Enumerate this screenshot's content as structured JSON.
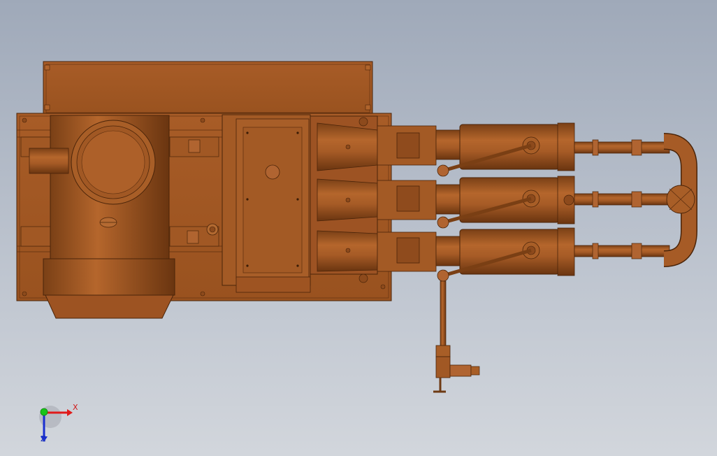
{
  "viewport": {
    "background_top": "#9fa9b9",
    "background_bottom": "#d2d6dc",
    "model_color": "#a65b26",
    "model_shadow": "#6e3a14",
    "model_highlight": "#c8773a"
  },
  "model": {
    "description_icon": "cad-assembly",
    "components": [
      "base-frame",
      "motor-housing",
      "gearbox-cover",
      "pump-cylinder",
      "pump-cylinder",
      "pump-cylinder",
      "manifold-pipe",
      "drain-valve"
    ]
  },
  "triad": {
    "x_label": "X",
    "z_label": "Z",
    "x_color": "#e01a1a",
    "y_color": "#18c418",
    "z_color": "#1a2fd0"
  }
}
